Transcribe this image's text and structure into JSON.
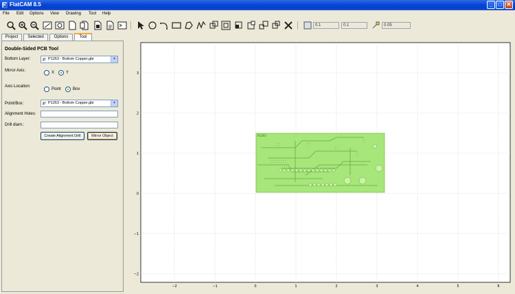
{
  "window": {
    "title": "FlatCAM 8.5",
    "minimize": "_",
    "maximize": "□",
    "close": "✕"
  },
  "menu": [
    "File",
    "Edit",
    "Options",
    "View",
    "Drawing",
    "Tool",
    "Help"
  ],
  "toolbar": {
    "icons": [
      "zoom-fit-icon",
      "zoom-in-icon",
      "zoom-out-icon",
      "clear-plot-icon",
      "replot-icon",
      "new-geometry-icon",
      "new-excellon-icon",
      "delete-icon",
      "report-icon",
      "shell-icon"
    ],
    "draw_icons": [
      "select-icon",
      "circle-icon",
      "arc-icon",
      "rectangle-icon",
      "polygon-icon",
      "path-icon",
      "union-icon",
      "intersection-icon",
      "subtract-icon",
      "cut-icon",
      "copy-icon",
      "move-icon",
      "buffer-icon",
      "delete-shape-icon"
    ],
    "grid_x": "0.1",
    "grid_y": "0.1",
    "snap_max": "0.05"
  },
  "tabs": [
    "Project",
    "Selected",
    "Options",
    "Tool"
  ],
  "active_tab": "Tool",
  "tool": {
    "title": "Double-Sided PCB Tool",
    "bottom_layer_label": "Bottom Layer:",
    "bottom_layer_value": "P1263 - Bottom Copper.gbr",
    "mirror_axis_label": "Mirror Axis:",
    "mirror_x": "X",
    "mirror_y": "Y",
    "axis_location_label": "Axis Location:",
    "axis_point": "Point",
    "axis_box": "Box",
    "point_box_label": "Point/Box:",
    "point_box_value": "P1263 - Bottom Copper.gbr",
    "alignment_holes_label": "Alignment Holes:",
    "drill_diam_label": "Drill diam.:",
    "create_drill_button": "Create Alignment Drill",
    "mirror_button": "Mirror Object"
  },
  "plot": {
    "x_ticks": [
      "−2",
      "−1",
      "0",
      "1",
      "2",
      "3",
      "4",
      "5",
      "6"
    ],
    "y_ticks": [
      "3",
      "2",
      "1",
      "0",
      "−1",
      "−2"
    ],
    "board_label": "P1263",
    "board_color": "#a6e67a",
    "board_edge": "#7dc04a"
  }
}
